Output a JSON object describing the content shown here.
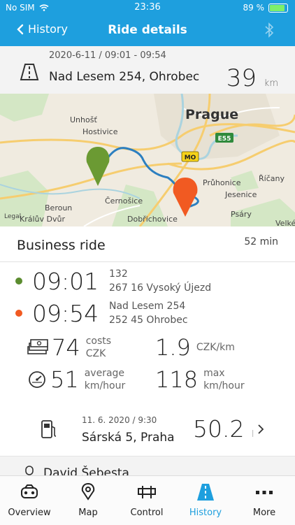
{
  "status_bar": {
    "carrier": "No SIM",
    "time": "23:36",
    "battery": "89 %",
    "battery_fraction": 0.89
  },
  "nav": {
    "back_label": "History",
    "title": "Ride details"
  },
  "destination": {
    "date_range": "2020-6-11 / 09:01 - 09:54",
    "address": "Nad Lesem 254, Ohrobec",
    "distance": "39",
    "distance_unit": "km"
  },
  "map": {
    "labels": [
      "Prague",
      "Unhošť",
      "Hostivice",
      "Průhonice",
      "Říčany",
      "Jesenice",
      "Černošice",
      "Beroun",
      "Králův Dvůr",
      "Dobřichovice",
      "Psáry",
      "Velké",
      "Legal"
    ],
    "road_badges": [
      "MO",
      "E55"
    ]
  },
  "ride": {
    "type": "Business ride",
    "duration": "52 min",
    "start": {
      "time": "09:01",
      "line1": "132",
      "line2": "267 16 Vysoký Újezd",
      "color": "#5b8c2f"
    },
    "end": {
      "time": "09:54",
      "line1": "Nad Lesem 254",
      "line2": "252 45 Ohrobec",
      "color": "#f15a22"
    },
    "costs": {
      "value": "74",
      "label1": "costs",
      "label2": "CZK"
    },
    "per_km": {
      "value": "1.9",
      "label": "CZK/km"
    },
    "avg_speed": {
      "value": "51",
      "label1": "average",
      "label2": "km/hour"
    },
    "max_speed": {
      "value": "118",
      "label1": "max",
      "label2": "km/hour"
    }
  },
  "refuel": {
    "date": "11. 6. 2020 / 9:30",
    "address": "Sárská 5, Praha",
    "amount": "50.2",
    "unit": "l"
  },
  "driver": {
    "name": "David Šebesta"
  },
  "tabs": [
    {
      "label": "Overview",
      "icon": "car-icon"
    },
    {
      "label": "Map",
      "icon": "map-pin-icon"
    },
    {
      "label": "Control",
      "icon": "control-icon"
    },
    {
      "label": "History",
      "icon": "road-icon"
    },
    {
      "label": "More",
      "icon": "more-icon"
    }
  ]
}
